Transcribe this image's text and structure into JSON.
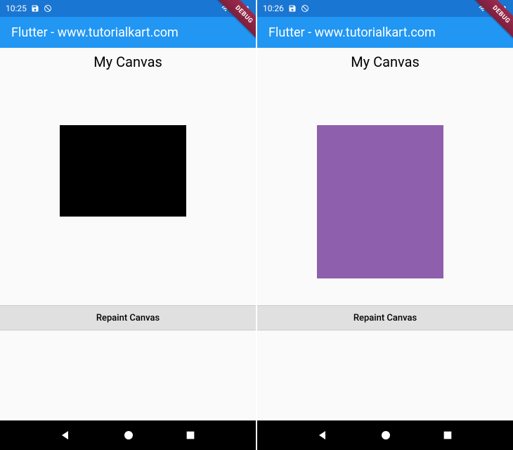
{
  "screens": [
    {
      "statusTime": "10:25",
      "appBarTitle": "Flutter - www.tutorialkart.com",
      "debugLabel": "DEBUG",
      "canvasTitle": "My Canvas",
      "buttonLabel": "Repaint Canvas",
      "rectColor": "#000000",
      "rectClass": "rect-black"
    },
    {
      "statusTime": "10:26",
      "appBarTitle": "Flutter - www.tutorialkart.com",
      "debugLabel": "DEBUG",
      "canvasTitle": "My Canvas",
      "buttonLabel": "Repaint Canvas",
      "rectColor": "#8E5FAC",
      "rectClass": "rect-purple"
    }
  ],
  "colors": {
    "statusBar": "#1976D2",
    "appBar": "#2196F3",
    "navBar": "#000000",
    "buttonBg": "#e0e0e0"
  }
}
